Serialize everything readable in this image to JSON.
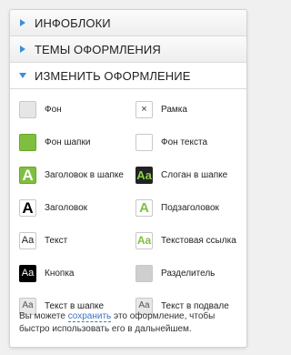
{
  "sections": [
    {
      "title": "ИНФОБЛОКИ",
      "open": false
    },
    {
      "title": "ТЕМЫ ОФОРМЛЕНИЯ",
      "open": false
    },
    {
      "title": "ИЗМЕНИТЬ ОФОРМЛЕНИЕ",
      "open": true
    }
  ],
  "items": [
    {
      "label": "Фон",
      "icon": "background-swatch"
    },
    {
      "label": "Рамка",
      "icon": "frame-swatch",
      "glyph": "×"
    },
    {
      "label": "Фон шапки",
      "icon": "header-background-swatch"
    },
    {
      "label": "Фон текста",
      "icon": "text-background-swatch"
    },
    {
      "label": "Заголовок в шапке",
      "icon": "header-title-swatch",
      "glyph": "A"
    },
    {
      "label": "Слоган в шапке",
      "icon": "header-slogan-swatch",
      "glyph": "Aa"
    },
    {
      "label": "Заголовок",
      "icon": "title-swatch",
      "glyph": "A"
    },
    {
      "label": "Подзаголовок",
      "icon": "subtitle-swatch",
      "glyph": "A"
    },
    {
      "label": "Текст",
      "icon": "text-swatch",
      "glyph": "Aa"
    },
    {
      "label": "Текстовая ссылка",
      "icon": "text-link-swatch",
      "glyph": "Aa"
    },
    {
      "label": "Кнопка",
      "icon": "button-swatch",
      "glyph": "Aa"
    },
    {
      "label": "Разделитель",
      "icon": "divider-swatch"
    },
    {
      "label": "Текст в шапке",
      "icon": "header-text-swatch",
      "glyph": "Aa"
    },
    {
      "label": "Текст в подвале",
      "icon": "footer-text-swatch",
      "glyph": "Aa"
    }
  ],
  "note": {
    "before": "Вы можете ",
    "link": "сохранить",
    "after": " это оформление, чтобы быстро использовать его в дальнейшем."
  },
  "colors": {
    "accent": "#7fbf3f",
    "link": "#3a76c4",
    "arrow": "#3a8fd8"
  }
}
